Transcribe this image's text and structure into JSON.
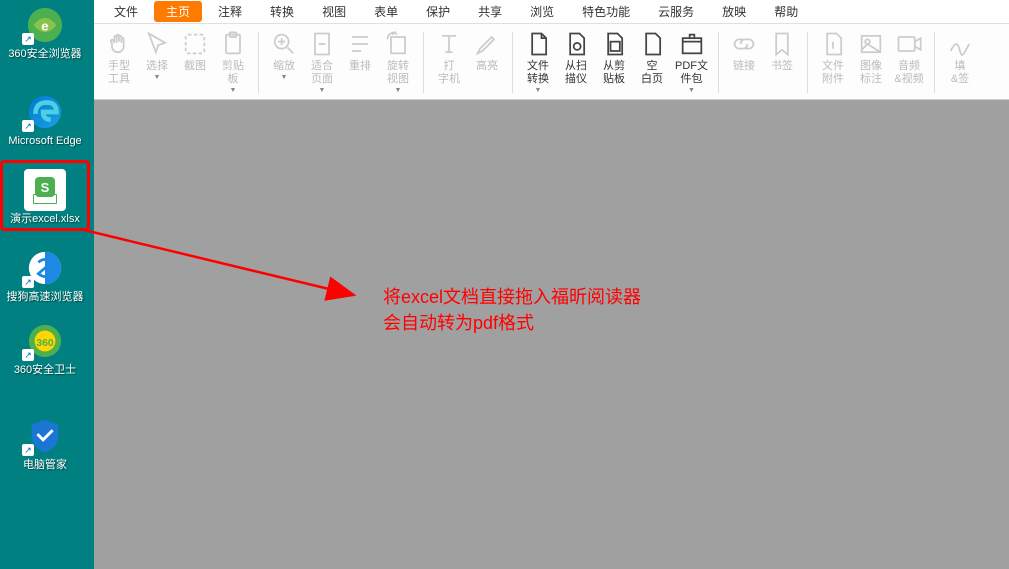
{
  "desktop": {
    "icons": [
      {
        "label": "360安全浏览器",
        "type": "360browser"
      },
      {
        "label": "Microsoft Edge",
        "type": "edge"
      },
      {
        "label": "演示excel.xlsx",
        "type": "excel",
        "selected": true
      },
      {
        "label": "搜狗高速浏览器",
        "type": "sogou"
      },
      {
        "label": "360安全卫士",
        "type": "360safe"
      },
      {
        "label": "电脑管家",
        "type": "pcmanager"
      }
    ]
  },
  "menu": {
    "tabs": [
      "文件",
      "主页",
      "注释",
      "转换",
      "视图",
      "表单",
      "保护",
      "共享",
      "浏览",
      "特色功能",
      "云服务",
      "放映",
      "帮助"
    ],
    "active": "主页"
  },
  "ribbon": {
    "groups": [
      [
        {
          "label": "手型\n工具",
          "icon": "hand",
          "dropdown": true
        },
        {
          "label": "选择",
          "icon": "select",
          "dropdown": true
        },
        {
          "label": "截图",
          "icon": "screenshot"
        },
        {
          "label": "剪贴\n板",
          "icon": "clipboard",
          "dropdown": true
        }
      ],
      [
        {
          "label": "缩放",
          "icon": "zoom",
          "dropdown": true
        },
        {
          "label": "适合\n页面",
          "icon": "fitpage",
          "dropdown": true
        },
        {
          "label": "重排",
          "icon": "reflow"
        },
        {
          "label": "旋转\n视图",
          "icon": "rotate",
          "dropdown": true
        }
      ],
      [
        {
          "label": "打\n字机",
          "icon": "typewriter"
        },
        {
          "label": "高亮",
          "icon": "highlight"
        }
      ],
      [
        {
          "label": "文件\n转换",
          "icon": "convert",
          "dropdown": true,
          "active": true
        },
        {
          "label": "从扫\n描仪",
          "icon": "scanner",
          "active": true
        },
        {
          "label": "从剪\n贴板",
          "icon": "fromclip",
          "active": true
        },
        {
          "label": "空\n白页",
          "icon": "blank",
          "active": true
        },
        {
          "label": "PDF文\n件包",
          "icon": "pdfpack",
          "dropdown": true,
          "active": true
        }
      ],
      [
        {
          "label": "链接",
          "icon": "link"
        },
        {
          "label": "书签",
          "icon": "bookmark"
        }
      ],
      [
        {
          "label": "文件\n附件",
          "icon": "attachment"
        },
        {
          "label": "图像\n标注",
          "icon": "imgannotate"
        },
        {
          "label": "音频\n&视频",
          "icon": "media"
        }
      ],
      [
        {
          "label": "填\n&签",
          "icon": "fillsign"
        }
      ]
    ]
  },
  "annotation": {
    "line1": "将excel文档直接拖入福昕阅读器",
    "line2": "会自动转为pdf格式"
  }
}
